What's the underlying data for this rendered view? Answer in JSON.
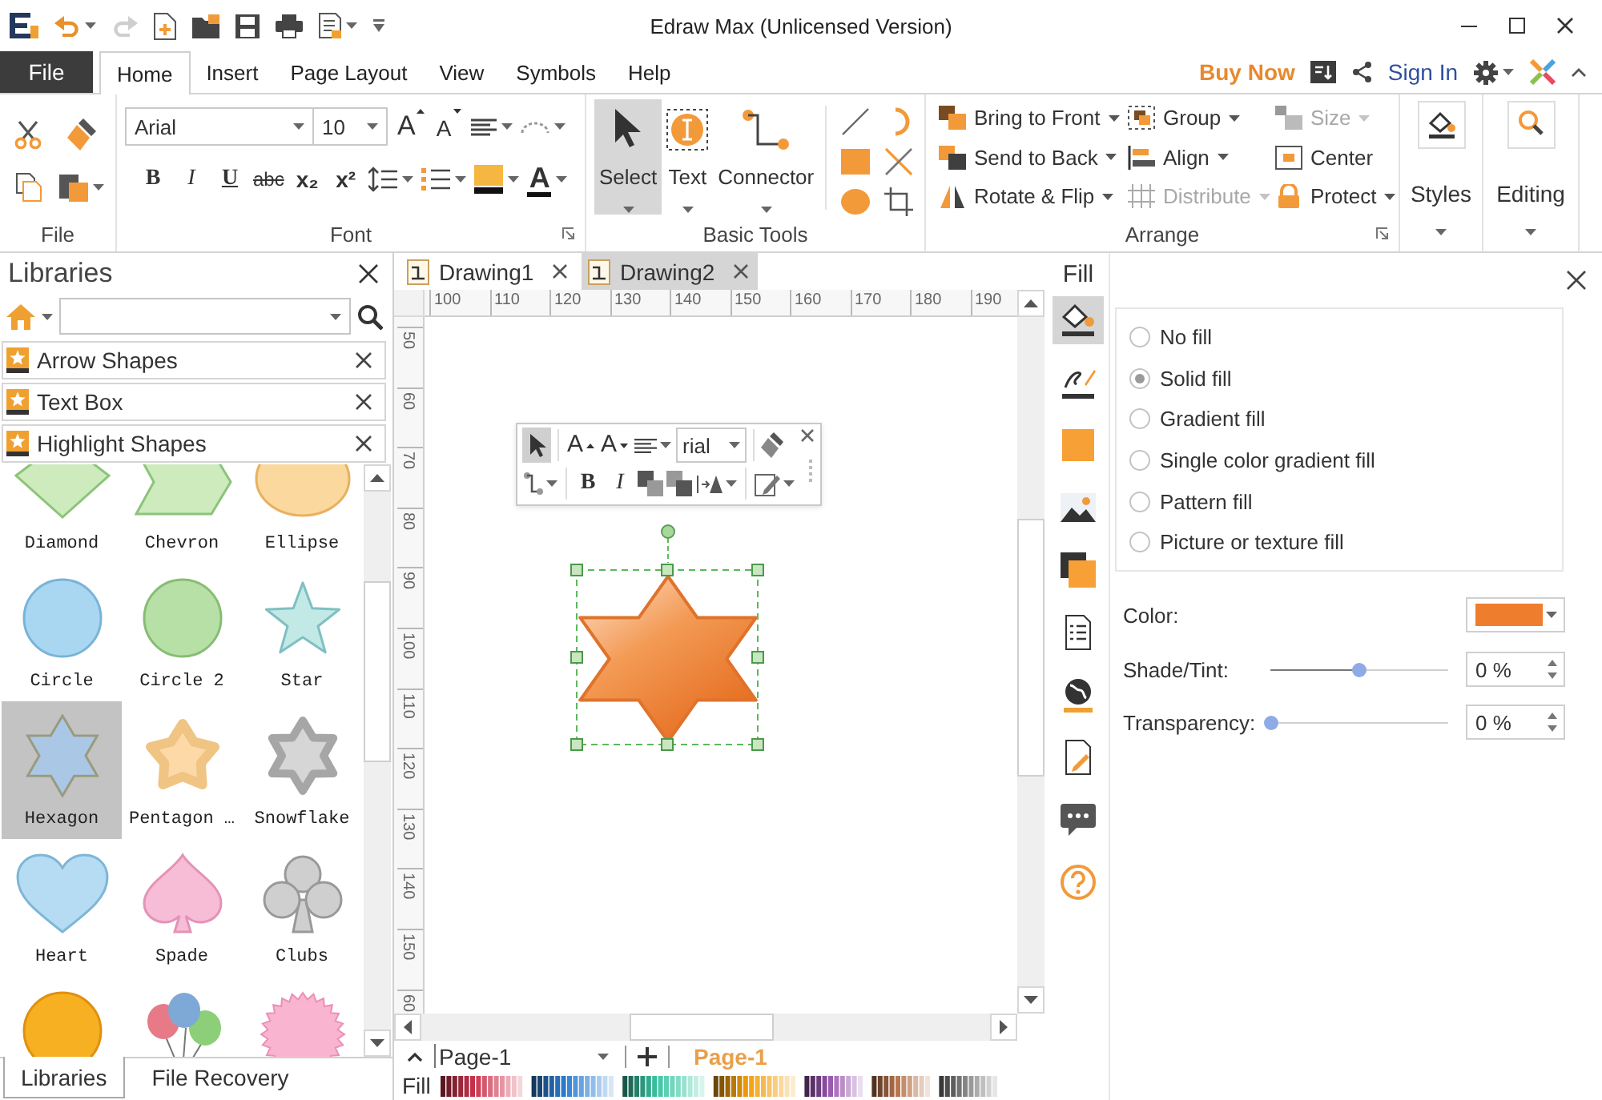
{
  "title_bar": {
    "title": "Edraw Max (Unlicensed Version)",
    "redo": {
      "disabled": true
    }
  },
  "menu": {
    "tabs": [
      {
        "label": "File",
        "kind": "backstage",
        "selected": false
      },
      {
        "label": "Home",
        "kind": "tab",
        "selected": true
      },
      {
        "label": "Insert",
        "kind": "tab",
        "selected": false
      },
      {
        "label": "Page Layout",
        "kind": "tab",
        "selected": false
      },
      {
        "label": "View",
        "kind": "tab",
        "selected": false
      },
      {
        "label": "Symbols",
        "kind": "tab",
        "selected": false
      },
      {
        "label": "Help",
        "kind": "tab",
        "selected": false
      }
    ],
    "buy_now": "Buy Now",
    "sign_in": "Sign In"
  },
  "ribbon": {
    "file_group": {
      "label": "File"
    },
    "font_group": {
      "label": "Font",
      "font_name": "Arial",
      "font_size": "10",
      "grow_font": "A",
      "shrink_font": "A",
      "styles": [
        "B",
        "I",
        "U",
        "abc",
        "x₂",
        "x²"
      ],
      "font_color": "A"
    },
    "basic_tools": {
      "label": "Basic Tools",
      "tools": [
        {
          "label": "Select",
          "selected": true
        },
        {
          "label": "Text",
          "selected": false
        },
        {
          "label": "Connector",
          "selected": false
        }
      ]
    },
    "arrange": {
      "label": "Arrange",
      "items": [
        {
          "label": "Bring to Front",
          "dropdown": true,
          "disabled": false
        },
        {
          "label": "Group",
          "dropdown": true,
          "disabled": false
        },
        {
          "label": "Size",
          "dropdown": true,
          "disabled": true
        },
        {
          "label": "Send to Back",
          "dropdown": true,
          "disabled": false
        },
        {
          "label": "Align",
          "dropdown": true,
          "disabled": false
        },
        {
          "label": "Center",
          "dropdown": false,
          "disabled": false
        },
        {
          "label": "Rotate & Flip",
          "dropdown": true,
          "disabled": false
        },
        {
          "label": "Distribute",
          "dropdown": true,
          "disabled": true
        },
        {
          "label": "Protect",
          "dropdown": true,
          "disabled": false
        }
      ]
    },
    "styles": {
      "label": "Styles"
    },
    "editing": {
      "label": "Editing"
    }
  },
  "libraries": {
    "title": "Libraries",
    "categories": [
      {
        "label": "Arrow Shapes"
      },
      {
        "label": "Text Box"
      },
      {
        "label": "Highlight Shapes"
      }
    ],
    "shapes": [
      {
        "label": "Diamond",
        "selected": false
      },
      {
        "label": "Chevron",
        "selected": false
      },
      {
        "label": "Ellipse",
        "selected": false
      },
      {
        "label": "Circle",
        "selected": false
      },
      {
        "label": "Circle 2",
        "selected": false
      },
      {
        "label": "Star",
        "selected": false
      },
      {
        "label": "Hexagon",
        "selected": true
      },
      {
        "label": "Pentagon …",
        "selected": false
      },
      {
        "label": "Snowflake",
        "selected": false
      },
      {
        "label": "Heart",
        "selected": false
      },
      {
        "label": "Spade",
        "selected": false
      },
      {
        "label": "Clubs",
        "selected": false
      },
      {
        "selected": false
      },
      {
        "selected": false
      },
      {
        "selected": false
      }
    ],
    "bottom_tabs": [
      {
        "label": "Libraries",
        "selected": true
      },
      {
        "label": "File Recovery",
        "selected": false
      }
    ]
  },
  "documents": [
    {
      "label": "Drawing1",
      "selected": false
    },
    {
      "label": "Drawing2",
      "selected": true
    }
  ],
  "rulers": {
    "horizontal": [
      "100",
      "110",
      "120",
      "130",
      "140",
      "150",
      "160",
      "170",
      "180",
      "190"
    ],
    "vertical": [
      "50",
      "60",
      "70",
      "80",
      "90",
      "100",
      "110",
      "120",
      "130",
      "140",
      "150",
      "60"
    ]
  },
  "canvas": {
    "mini_toolbar": {
      "pointer_selected": true,
      "grow_font": "A",
      "shrink_font": "A",
      "font": "rial",
      "bold": "B",
      "italic": "I"
    }
  },
  "pages": {
    "selector": "Page-1",
    "tabs": [
      {
        "label": "Page-1",
        "selected": true
      }
    ]
  },
  "palette": {
    "label": "Fill"
  },
  "fill_panel": {
    "title": "Fill",
    "side_tabs": [
      {
        "selected": true
      },
      {
        "selected": false
      },
      {
        "selected": false
      },
      {
        "selected": false
      },
      {
        "selected": false
      },
      {
        "selected": false
      },
      {
        "selected": false
      },
      {
        "selected": false
      },
      {
        "selected": false
      },
      {
        "selected": false
      }
    ],
    "options": [
      {
        "label": "No fill",
        "selected": false
      },
      {
        "label": "Solid fill",
        "selected": true
      },
      {
        "label": "Gradient fill",
        "selected": false
      },
      {
        "label": "Single color gradient fill",
        "selected": false
      },
      {
        "label": "Pattern fill",
        "selected": false
      },
      {
        "label": "Picture or texture fill",
        "selected": false
      }
    ],
    "color": {
      "label": "Color:",
      "color": "#ef7d2e"
    },
    "shade": {
      "label": "Shade/Tint:",
      "level": 0.5,
      "value": "0 %"
    },
    "transparency": {
      "label": "Transparency:",
      "level": 0,
      "value": "0 %"
    }
  }
}
